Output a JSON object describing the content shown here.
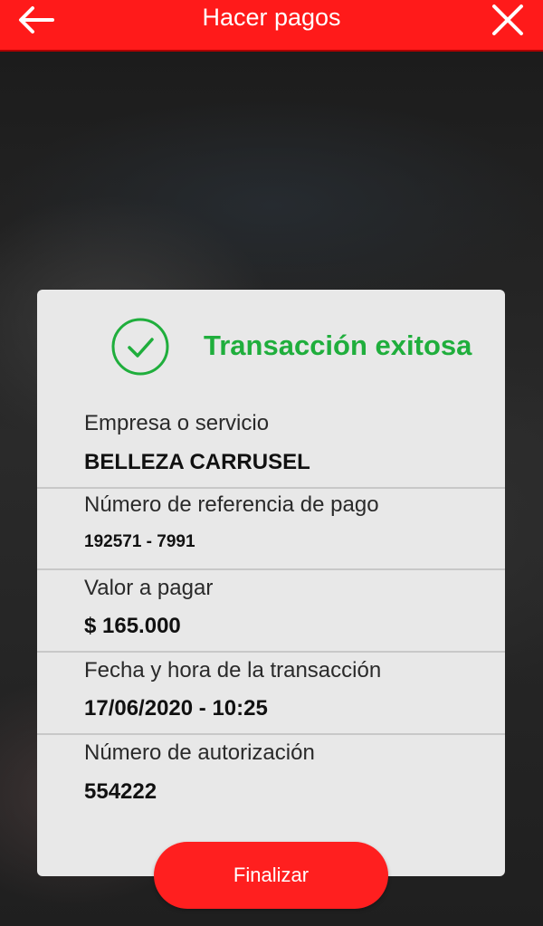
{
  "header": {
    "title": "Hacer pagos",
    "back_icon": "arrow-left-icon",
    "close_icon": "close-icon"
  },
  "status": {
    "text": "Transacción exitosa",
    "icon": "check-circle-icon",
    "color": "#1fae3c"
  },
  "fields": [
    {
      "label": "Empresa o servicio",
      "value": "BELLEZA CARRUSEL"
    },
    {
      "label": "Número de referencia de pago",
      "value": "192571 - 7991"
    },
    {
      "label": "Valor a pagar",
      "value": "$ 165.000"
    },
    {
      "label": "Fecha y hora de la transacción",
      "value": "17/06/2020 - 10:25"
    },
    {
      "label": "Número de autorización",
      "value": "554222"
    }
  ],
  "actions": {
    "finish_label": "Finalizar"
  },
  "colors": {
    "brand_red": "#ff1a1a",
    "card_bg": "#e8e8e8"
  }
}
